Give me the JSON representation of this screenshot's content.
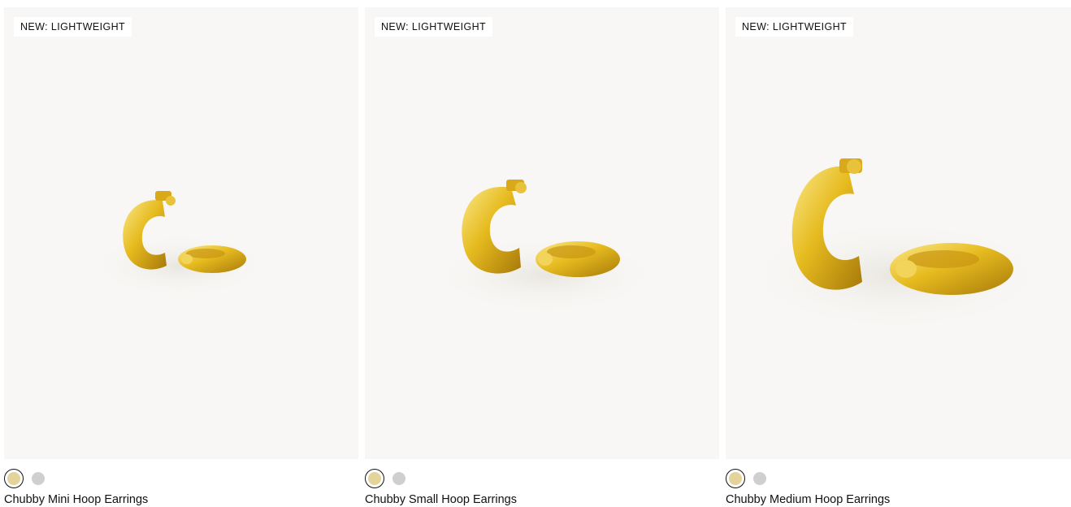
{
  "products": [
    {
      "badge": "NEW: LIGHTWEIGHT",
      "name": "Chubby Mini Hoop Earrings",
      "swatches": [
        {
          "metal": "gold",
          "color": "#e4d39a",
          "selected": true
        },
        {
          "metal": "silver",
          "color": "#cfcfcf",
          "selected": false
        }
      ]
    },
    {
      "badge": "NEW: LIGHTWEIGHT",
      "name": "Chubby Small Hoop Earrings",
      "swatches": [
        {
          "metal": "gold",
          "color": "#e4d39a",
          "selected": true
        },
        {
          "metal": "silver",
          "color": "#cfcfcf",
          "selected": false
        }
      ]
    },
    {
      "badge": "NEW: LIGHTWEIGHT",
      "name": "Chubby Medium Hoop Earrings",
      "swatches": [
        {
          "metal": "gold",
          "color": "#e4d39a",
          "selected": true
        },
        {
          "metal": "silver",
          "color": "#cfcfcf",
          "selected": false
        }
      ]
    }
  ],
  "colors": {
    "image_bg": "#f8f7f5",
    "gold_light": "#f7e27a",
    "gold_mid": "#e3b81c",
    "gold_dark": "#a8790a"
  }
}
